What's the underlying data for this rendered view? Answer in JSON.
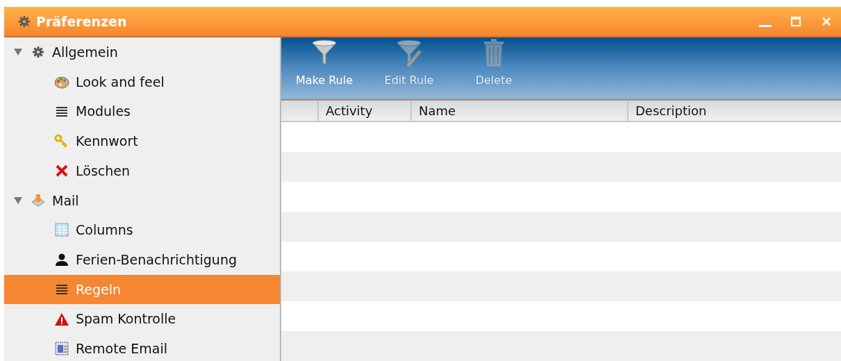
{
  "window": {
    "title": "Präferenzen"
  },
  "tree": [
    {
      "label": "Allgemein",
      "kind": "gear",
      "expanded": true,
      "selected": false,
      "children": [
        {
          "label": "Look and feel",
          "kind": "palette",
          "selected": false
        },
        {
          "label": "Modules",
          "kind": "lines",
          "selected": false
        },
        {
          "label": "Kennwort",
          "kind": "key",
          "selected": false
        },
        {
          "label": "Löschen",
          "kind": "cross",
          "selected": false
        }
      ]
    },
    {
      "label": "Mail",
      "kind": "inbox",
      "expanded": true,
      "selected": false,
      "children": [
        {
          "label": "Columns",
          "kind": "grid",
          "selected": false
        },
        {
          "label": "Ferien-Benachrichtigung",
          "kind": "person",
          "selected": false
        },
        {
          "label": "Regeln",
          "kind": "lines",
          "selected": true
        },
        {
          "label": "Spam Kontrolle",
          "kind": "warning",
          "selected": false
        },
        {
          "label": "Remote Email",
          "kind": "remote",
          "selected": false
        }
      ]
    }
  ],
  "toolbar": [
    {
      "label": "Make Rule",
      "kind": "funnel",
      "disabled": false
    },
    {
      "label": "Edit Rule",
      "kind": "funnelpencil",
      "disabled": true
    },
    {
      "label": "Delete",
      "kind": "trash",
      "disabled": true
    }
  ],
  "table": {
    "columns": [
      "Activity",
      "Name",
      "Description"
    ]
  }
}
